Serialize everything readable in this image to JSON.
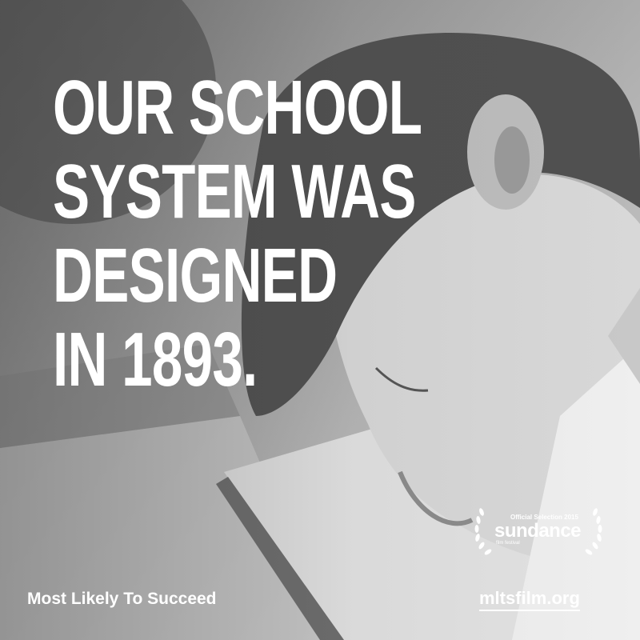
{
  "headline": {
    "lines": [
      "OUR SCHOOL",
      "SYSTEM WAS",
      "DESIGNED",
      "IN 1893."
    ]
  },
  "laurel": {
    "selection_text": "Official Selection 2015",
    "name": "sundance",
    "festival_text": "film festival"
  },
  "footer": {
    "film_title": "Most Likely To Succeed",
    "website": "mltsfilm.org"
  }
}
